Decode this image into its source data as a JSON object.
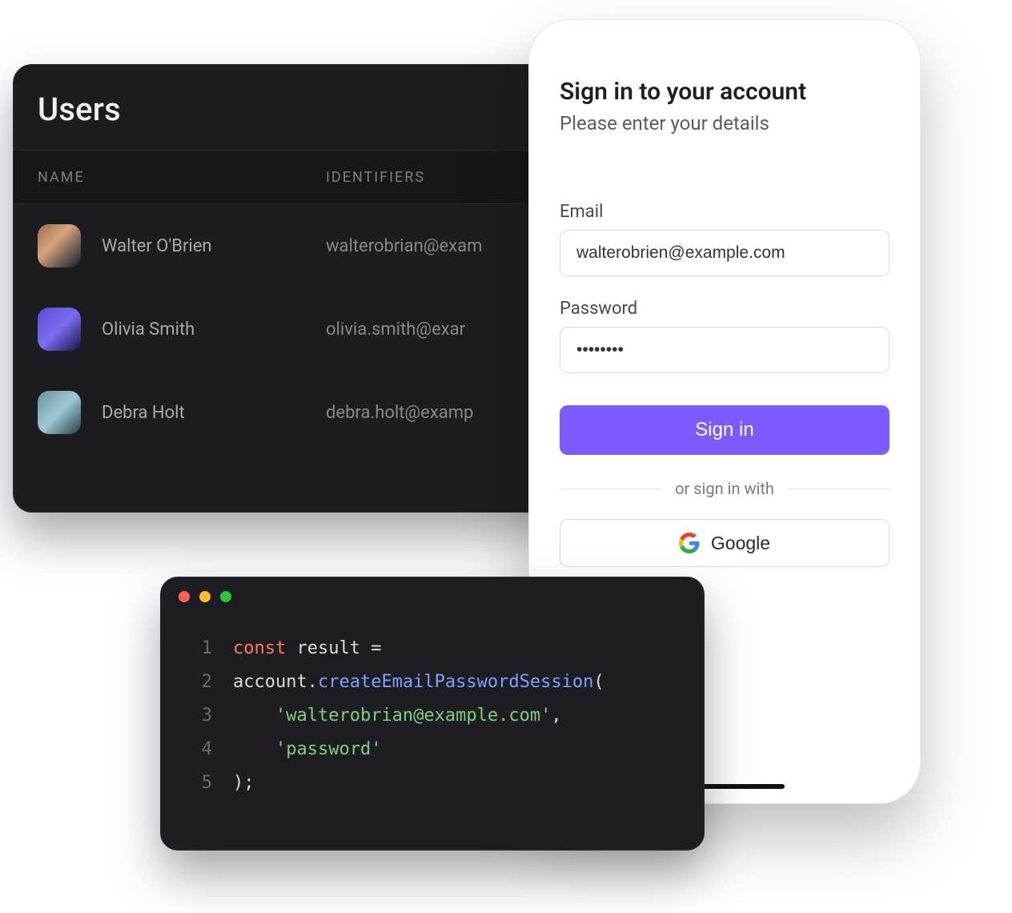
{
  "users": {
    "title": "Users",
    "columns": {
      "name": "NAME",
      "ident": "IDENTIFIERS"
    },
    "rows": [
      {
        "name": "Walter O'Brien",
        "ident": "walterobrian@exam"
      },
      {
        "name": "Olivia Smith",
        "ident": "olivia.smith@exar"
      },
      {
        "name": "Debra Holt",
        "ident": "debra.holt@examp"
      }
    ]
  },
  "signin": {
    "title": "Sign in to your account",
    "subtitle": "Please enter your details",
    "email_label": "Email",
    "email_value": "walterobrien@example.com",
    "password_label": "Password",
    "password_value": "••••••••",
    "submit_label": "Sign in",
    "divider_text": "or sign in with",
    "oauth_label": "Google"
  },
  "code": {
    "tokens": {
      "const": "const",
      "result": "result",
      "eq": "=",
      "account": "account",
      "dot": ".",
      "fn": "createEmailPasswordSession",
      "lp": "(",
      "arg1": "'walterobrian@example.com'",
      "comma": ",",
      "arg2": "'password'",
      "rp": ");"
    },
    "line_numbers": [
      "1",
      "2",
      "3",
      "4",
      "5"
    ]
  }
}
